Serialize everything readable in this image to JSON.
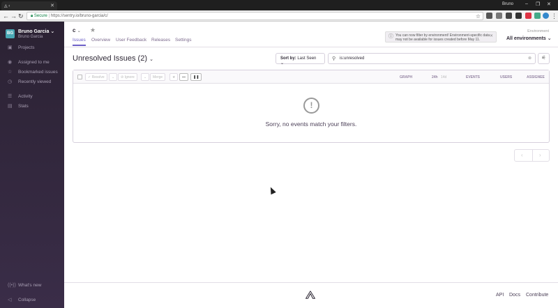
{
  "browser": {
    "tab_title": "◬ ‹",
    "user": "Bruno",
    "window_controls": [
      "–",
      "❐",
      "✕"
    ],
    "secure_label": "Secure",
    "url": "https://sentry.io/bruno-garcia/c/"
  },
  "sidebar": {
    "org_avatar": "BG",
    "org_name": "Bruno Garcia",
    "org_user": "Bruno Garcia",
    "items": [
      {
        "label": "Projects",
        "icon": "projects-icon"
      },
      {
        "label": "Assigned to me",
        "icon": "user-icon"
      },
      {
        "label": "Bookmarked issues",
        "icon": "star-icon"
      },
      {
        "label": "Recently viewed",
        "icon": "clock-icon"
      },
      {
        "label": "Activity",
        "icon": "activity-icon"
      },
      {
        "label": "Stats",
        "icon": "stats-icon"
      }
    ],
    "whats_new": "What's new",
    "collapse": "Collapse"
  },
  "header": {
    "project": "c",
    "tabs": [
      "Issues",
      "Overview",
      "User Feedback",
      "Releases",
      "Settings"
    ],
    "alert": "You can now filter by environment! Environment-specific data may not be available for issues created before May 11.",
    "env_label": "Environment",
    "env_value": "All environments"
  },
  "issues": {
    "title": "Unresolved Issues (2)",
    "sort_prefix": "Sort by:",
    "sort_value": "Last Seen",
    "search_value": "is:unresolved",
    "actions": [
      "Resolve",
      "Ignore",
      "Merge"
    ],
    "columns": {
      "graph": "GRAPH",
      "h24": "24h",
      "d14": "14d",
      "events": "EVENTS",
      "users": "USERS",
      "assignee": "ASSIGNEE"
    },
    "empty_message": "Sorry, no events match your filters."
  },
  "footer": {
    "links": [
      "API",
      "Docs",
      "Contribute"
    ]
  }
}
